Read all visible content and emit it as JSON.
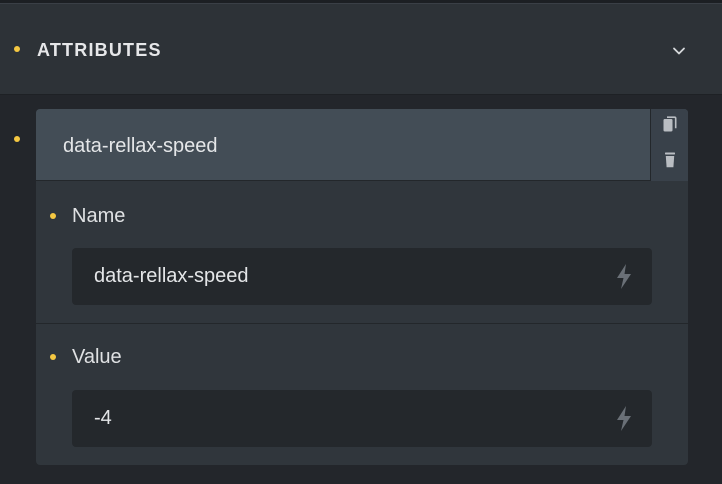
{
  "section": {
    "title": "ATTRIBUTES",
    "toggle_icon": "chevron-down-icon"
  },
  "attribute": {
    "header_title": "data-rellax-speed",
    "actions": {
      "copy_icon": "copy-icon",
      "delete_icon": "trash-icon"
    },
    "name": {
      "label": "Name",
      "value": "data-rellax-speed",
      "icon": "bolt-icon"
    },
    "value": {
      "label": "Value",
      "value": "-4",
      "icon": "bolt-icon"
    }
  },
  "colors": {
    "accent_dot": "#f5c842",
    "header_bg": "#2d3237",
    "card_head_bg": "#434d56",
    "card_bg": "#30363c",
    "input_bg": "#24282c"
  }
}
